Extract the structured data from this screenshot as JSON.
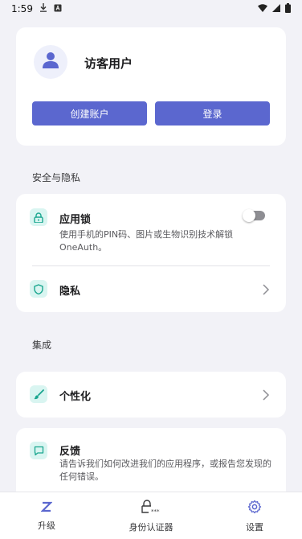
{
  "status_bar": {
    "time": "1:59"
  },
  "profile": {
    "name": "访客用户",
    "create_account_label": "创建账户",
    "login_label": "登录"
  },
  "sections": {
    "security_title": "安全与隐私",
    "integration_title": "集成"
  },
  "security": {
    "app_lock": {
      "title": "应用锁",
      "description": "使用手机的PIN码、图片或生物识别技术解锁 OneAuth。",
      "toggle_on": false
    },
    "privacy": {
      "title": "隐私"
    }
  },
  "integration": {
    "personalize": {
      "title": "个性化"
    },
    "feedback": {
      "title": "反馈",
      "description": "请告诉我们如何改进我们的应用程序，或报告您发现的任何错误。"
    }
  },
  "bottom_nav": {
    "items": [
      {
        "label": "升级",
        "icon": "upgrade-z-icon"
      },
      {
        "label": "身份认证器",
        "icon": "authenticator-lock-icon"
      },
      {
        "label": "设置",
        "icon": "gear-icon"
      }
    ],
    "active_index": 2
  },
  "colors": {
    "accent": "#5b67cf",
    "icon_tile": "#d9f5f1",
    "icon_teal": "#1aa68f",
    "background": "#f2f2f7"
  }
}
